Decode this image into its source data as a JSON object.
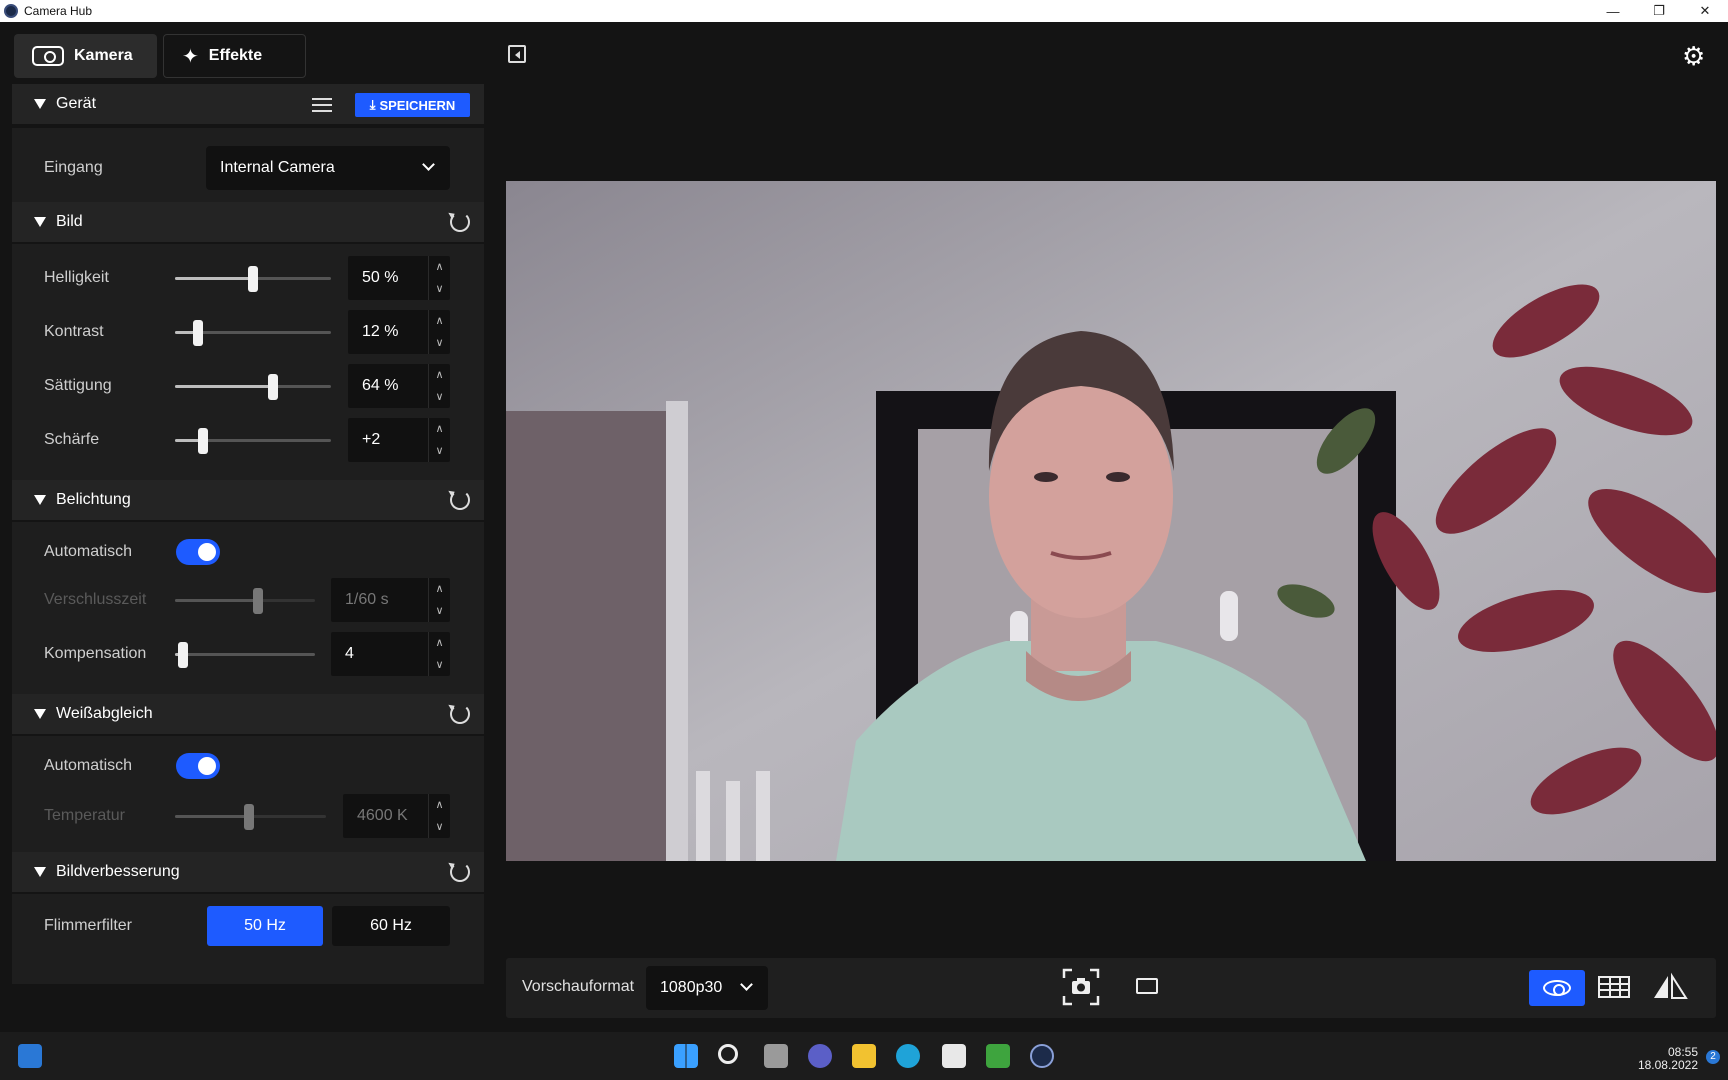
{
  "window": {
    "title": "Camera Hub"
  },
  "tabs": [
    {
      "label": "Kamera",
      "icon": "camera-icon",
      "active": true
    },
    {
      "label": "Effekte",
      "icon": "magic-wand-icon",
      "active": false
    }
  ],
  "geraet": {
    "title": "Gerät",
    "save_label": "SPEICHERN",
    "input_label": "Eingang",
    "input_value": "Internal Camera"
  },
  "bild": {
    "title": "Bild",
    "rows": [
      {
        "label": "Helligkeit",
        "value": "50 %",
        "level": 0.5
      },
      {
        "label": "Kontrast",
        "value": "12 %",
        "level": 0.12
      },
      {
        "label": "Sättigung",
        "value": "64 %",
        "level": 0.64
      },
      {
        "label": "Schärfe",
        "value": "+2",
        "level": 0.16
      }
    ]
  },
  "belichtung": {
    "title": "Belichtung",
    "auto_label": "Automatisch",
    "auto_on": true,
    "shutter_label": "Verschlusszeit",
    "shutter_value": "1/60 s",
    "shutter_level": 0.6,
    "comp_label": "Kompensation",
    "comp_value": "4",
    "comp_level": 0.02
  },
  "weissabgleich": {
    "title": "Weißabgleich",
    "auto_label": "Automatisch",
    "auto_on": true,
    "temp_label": "Temperatur",
    "temp_value": "4600 K",
    "temp_level": 0.49
  },
  "bildverbesserung": {
    "title": "Bildverbesserung",
    "flicker_label": "Flimmerfilter",
    "options": [
      "50 Hz",
      "60 Hz"
    ],
    "selected": "50 Hz"
  },
  "bottom": {
    "format_label": "Vorschauformat",
    "format_value": "1080p30"
  },
  "taskbar": {
    "time": "08:55",
    "date": "18.08.2022",
    "notifications": "2"
  },
  "colors": {
    "accent": "#1e5bff",
    "panel": "#1e1e1e",
    "section_head": "#242424",
    "background": "#141414"
  }
}
